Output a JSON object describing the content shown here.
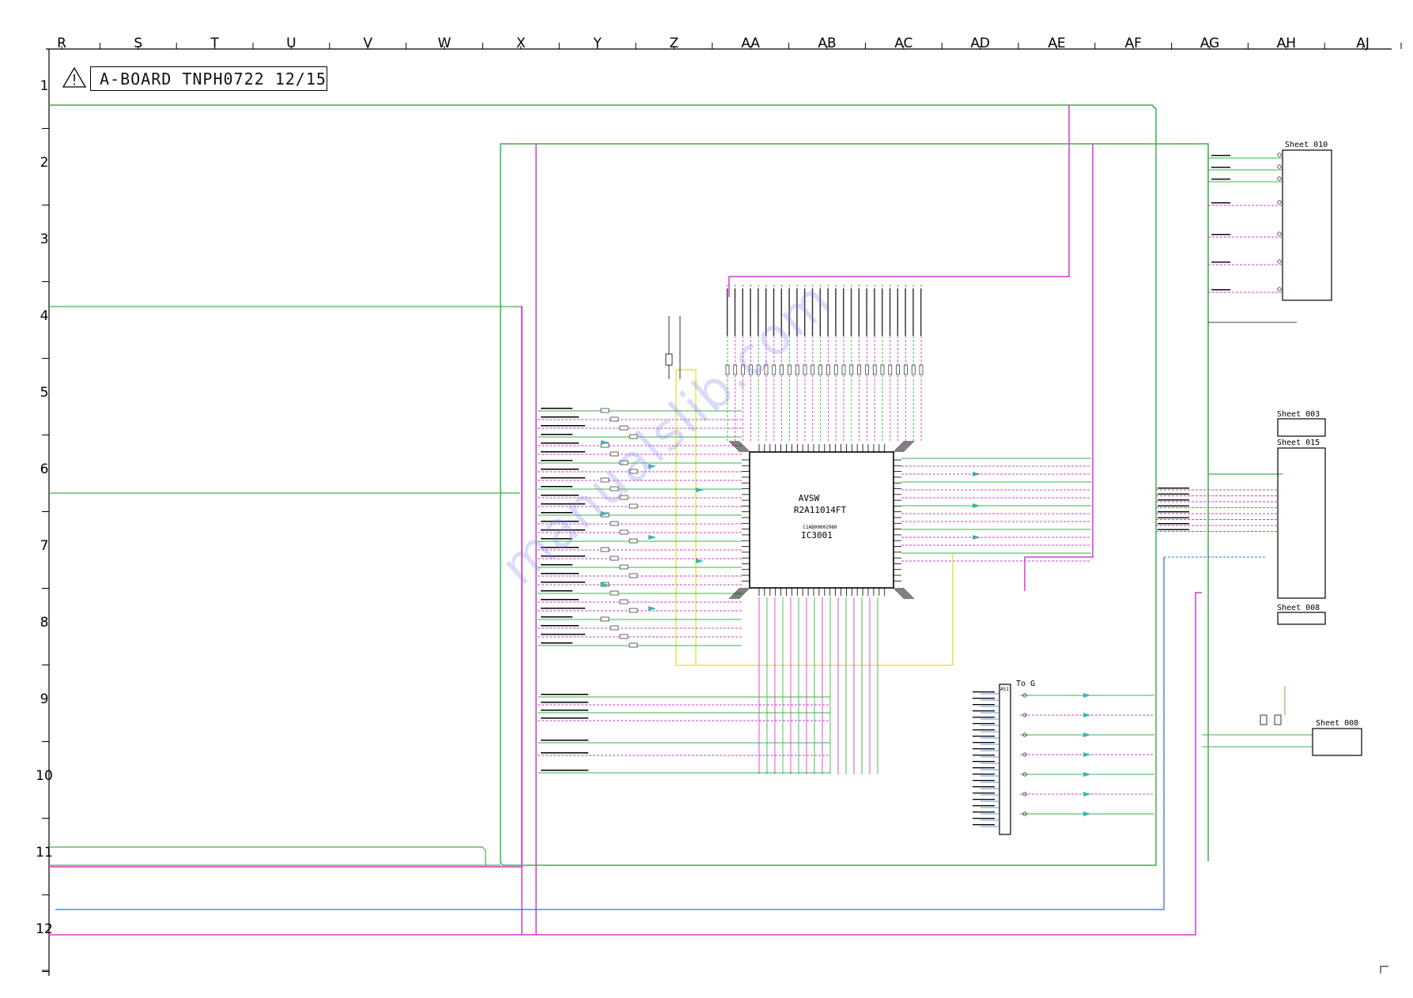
{
  "sheet": {
    "title": "A-BOARD TNPH0722 12/15",
    "columns": [
      "R",
      "S",
      "T",
      "U",
      "V",
      "W",
      "X",
      "Y",
      "Z",
      "AA",
      "AB",
      "AC",
      "AD",
      "AE",
      "AF",
      "AG",
      "AH",
      "AJ"
    ],
    "rows": [
      "1",
      "2",
      "3",
      "4",
      "5",
      "6",
      "7",
      "8",
      "9",
      "10",
      "11",
      "12"
    ]
  },
  "ic": {
    "name": "AVSW",
    "part": "R2A11014FT",
    "sub_code": "C1AB00002980",
    "ref": "IC3001"
  },
  "sheet_refs": [
    {
      "label": "Sheet 010"
    },
    {
      "label": "Sheet 003"
    },
    {
      "label": "Sheet 015"
    },
    {
      "label": "Sheet 008"
    },
    {
      "label": "Sheet 008"
    }
  ],
  "connector": {
    "label": "To G",
    "ref": "A51"
  },
  "watermark": "manualslib.com",
  "colors": {
    "green": "#3cb04a",
    "magenta": "#d23cd2",
    "blue": "#3a6fd8",
    "yellow": "#e8e040",
    "teal": "#36b8b0",
    "black": "#000000"
  }
}
